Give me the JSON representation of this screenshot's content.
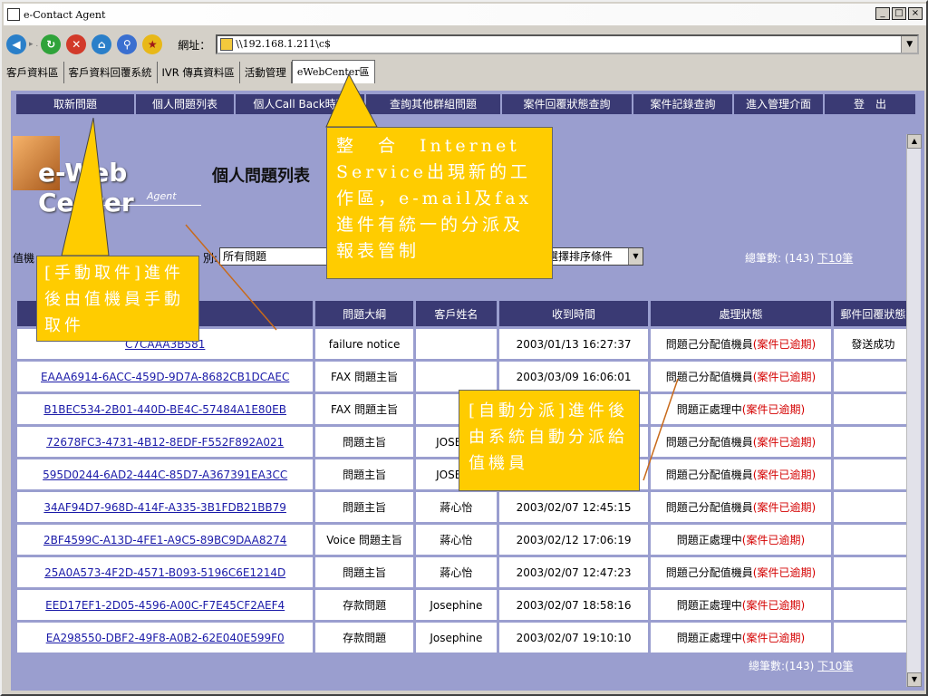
{
  "window": {
    "title": "e-Contact Agent",
    "buttons": [
      "_",
      "□",
      "×"
    ]
  },
  "toolbar": {
    "address_label": "網址：",
    "address_value": "\\\\192.168.1.211\\c$"
  },
  "app_tabs": [
    "客戶資料區",
    "客戶資料回覆系統",
    "IVR 傳真資料區",
    "活動管理",
    "eWebCenter區"
  ],
  "nav": [
    "取新問題",
    "個人問題列表",
    "個人Call Back時程",
    "查詢其他群組問題",
    "案件回覆狀態查詢",
    "案件記錄查詢",
    "進入管理介面",
    "登　出"
  ],
  "logo": {
    "brand": "e-Web Center",
    "sub": "Agent"
  },
  "page_title": "個人問題列表",
  "filters": {
    "label1": "值機",
    "label2": "別:",
    "category_value": "所有問題",
    "sort_value": "選擇排序條件"
  },
  "totals": {
    "top_text": "總筆數: (143)",
    "top_link": "下10筆",
    "bottom_text": "總筆數:(143)",
    "bottom_link": "下10筆"
  },
  "table": {
    "headers": [
      "",
      "問題大綱",
      "客戶姓名",
      "收到時間",
      "處理狀態",
      "郵件回覆狀態"
    ],
    "rows": [
      {
        "id": "C7CAAA3B581",
        "subject": "failure notice",
        "customer": "",
        "time": "2003/01/13 16:27:37",
        "status": "問題己分配值機員",
        "overdue": "(案件已逾期)",
        "mail": "發送成功"
      },
      {
        "id": "EAAA6914-6ACC-459D-9D7A-8682CB1DCAEC",
        "subject": "FAX 問題主旨",
        "customer": "",
        "time": "2003/03/09 16:06:01",
        "status": "問題己分配值機員",
        "overdue": "(案件已逾期)",
        "mail": ""
      },
      {
        "id": "B1BEC534-2B01-440D-BE4C-57484A1E80EB",
        "subject": "FAX 問題主旨",
        "customer": "",
        "time": "",
        "status": "問題正處理中",
        "overdue": "(案件已逾期)",
        "mail": ""
      },
      {
        "id": "72678FC3-4731-4B12-8EDF-F552F892A021",
        "subject": "問題主旨",
        "customer": "JOSEPH",
        "time": "",
        "status": "問題己分配值機員",
        "overdue": "(案件已逾期)",
        "mail": ""
      },
      {
        "id": "595D0244-6AD2-444C-85D7-A367391EA3CC",
        "subject": "問題主旨",
        "customer": "JOSEPH",
        "time": "",
        "status": "問題己分配值機員",
        "overdue": "(案件已逾期)",
        "mail": ""
      },
      {
        "id": "34AF94D7-968D-414F-A335-3B1FDB21BB79",
        "subject": "問題主旨",
        "customer": "蔣心怡",
        "time": "2003/02/07 12:45:15",
        "status": "問題己分配值機員",
        "overdue": "(案件已逾期)",
        "mail": ""
      },
      {
        "id": "2BF4599C-A13D-4FE1-A9C5-89BC9DAA8274",
        "subject": "Voice 問題主旨",
        "customer": "蔣心怡",
        "time": "2003/02/12 17:06:19",
        "status": "問題正處理中",
        "overdue": "(案件已逾期)",
        "mail": ""
      },
      {
        "id": "25A0A573-4F2D-4571-B093-5196C6E1214D",
        "subject": "問題主旨",
        "customer": "蔣心怡",
        "time": "2003/02/07 12:47:23",
        "status": "問題己分配值機員",
        "overdue": "(案件已逾期)",
        "mail": ""
      },
      {
        "id": "EED17EF1-2D05-4596-A00C-F7E45CF2AEF4",
        "subject": "存款問題",
        "customer": "Josephine",
        "time": "2003/02/07 18:58:16",
        "status": "問題正處理中",
        "overdue": "(案件已逾期)",
        "mail": ""
      },
      {
        "id": "EA298550-DBF2-49F8-A0B2-62E040E599F0",
        "subject": "存款問題",
        "customer": "Josephine",
        "time": "2003/02/07 19:10:10",
        "status": "問題正處理中",
        "overdue": "(案件已逾期)",
        "mail": ""
      }
    ]
  },
  "callouts": {
    "integration": "整　合　Internet Service出現新的工作區，e-mail及fax進件有統一的分派及報表管制",
    "manual": "[手動取件]進件後由值機員手動取件",
    "auto": "[自動分派]進件後由系統自動分派給值機員"
  },
  "colors": {
    "callout": "#ffcc00",
    "content_bg": "#9a9ecf",
    "nav_bg": "#3a3a74",
    "overdue": "#d40000"
  }
}
